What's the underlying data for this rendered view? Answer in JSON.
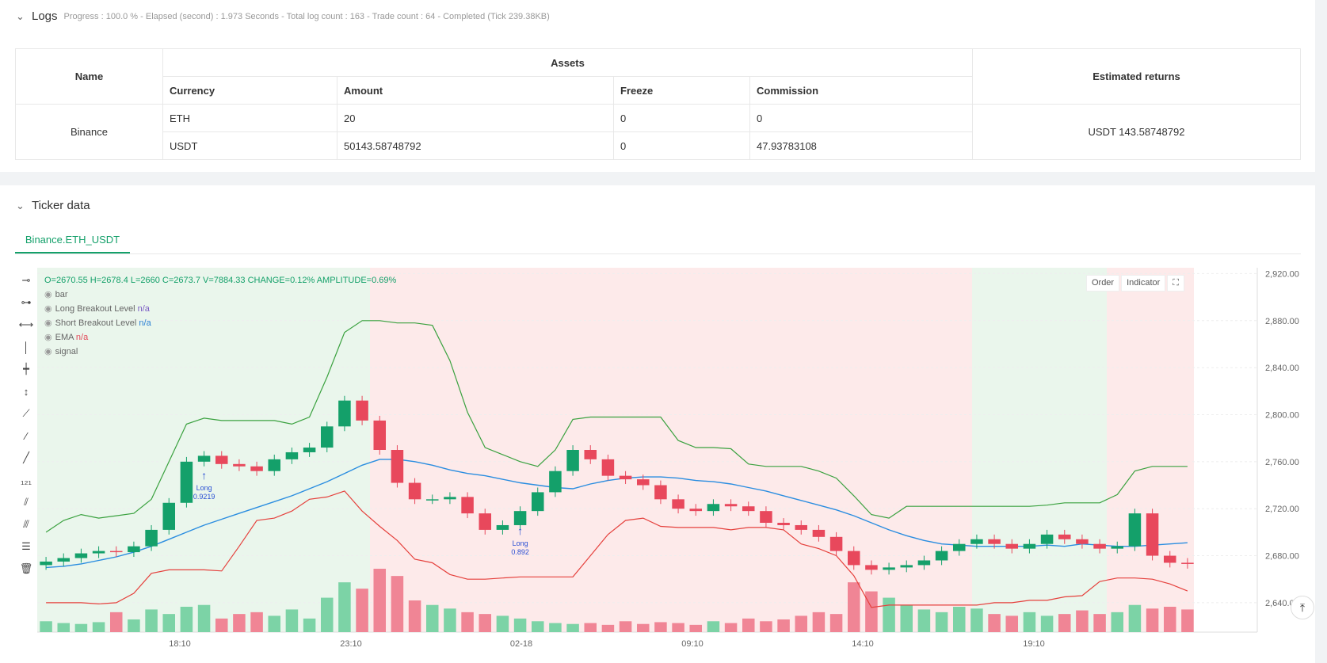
{
  "logs": {
    "title": "Logs",
    "progress": "Progress : 100.0 % - Elapsed (second) : 1.973  Seconds - Total log count : 163 - Trade count : 64 - Completed (Tick 239.38KB)"
  },
  "table": {
    "headers": {
      "name": "Name",
      "assets": "Assets",
      "returns": "Estimated returns",
      "currency": "Currency",
      "amount": "Amount",
      "freeze": "Freeze",
      "commission": "Commission"
    },
    "exchange": "Binance",
    "rows": [
      {
        "currency": "ETH",
        "amount": "20",
        "freeze": "0",
        "commission": "0"
      },
      {
        "currency": "USDT",
        "amount": "50143.58748792",
        "freeze": "0",
        "commission": "47.93783108"
      }
    ],
    "returns": "USDT 143.58748792"
  },
  "ticker": {
    "title": "Ticker data",
    "tab": "Binance.ETH_USDT"
  },
  "legend": {
    "ohlc": "O=2670.55 H=2678.4 L=2660 C=2673.7 V=7884.33 CHANGE=0.12% AMPLITUDE=0.69%",
    "items": [
      {
        "name": "bar",
        "value": ""
      },
      {
        "name": "Long Breakout Level",
        "value": "n/a"
      },
      {
        "name": "Short Breakout Level",
        "value": "n/a"
      },
      {
        "name": "EMA",
        "value": "n/a"
      },
      {
        "name": "signal",
        "value": ""
      }
    ]
  },
  "chart_buttons": {
    "order": "Order",
    "indicator": "Indicator"
  },
  "chart_data": {
    "type": "candlestick",
    "y_ticks": [
      "2,920.00",
      "2,880.00",
      "2,840.00",
      "2,800.00",
      "2,760.00",
      "2,720.00",
      "2,680.00",
      "2,640.00"
    ],
    "x_ticks": [
      "18:10",
      "23:10",
      "02-18",
      "09:10",
      "14:10",
      "19:10"
    ],
    "signals": [
      {
        "label": "Long",
        "value": "0.9219"
      },
      {
        "label": "Long",
        "value": "0.892"
      }
    ],
    "ema": [
      2670,
      2671,
      2673,
      2676,
      2679,
      2683,
      2688,
      2694,
      2700,
      2706,
      2711,
      2716,
      2721,
      2726,
      2731,
      2737,
      2743,
      2750,
      2757,
      2762,
      2762,
      2760,
      2757,
      2753,
      2750,
      2748,
      2745,
      2742,
      2740,
      2738,
      2737,
      2741,
      2744,
      2746,
      2747,
      2747,
      2746,
      2744,
      2743,
      2741,
      2738,
      2735,
      2731,
      2727,
      2723,
      2719,
      2714,
      2708,
      2702,
      2697,
      2693,
      2690,
      2689,
      2688,
      2688,
      2688,
      2688,
      2689,
      2688,
      2690,
      2689,
      2688,
      2688,
      2689,
      2690,
      2691
    ],
    "upper": [
      2700,
      2710,
      2715,
      2712,
      2714,
      2716,
      2728,
      2760,
      2792,
      2797,
      2795,
      2795,
      2795,
      2795,
      2792,
      2798,
      2832,
      2870,
      2880,
      2880,
      2878,
      2878,
      2876,
      2846,
      2802,
      2772,
      2766,
      2760,
      2756,
      2770,
      2796,
      2798,
      2798,
      2798,
      2798,
      2798,
      2778,
      2772,
      2772,
      2771,
      2758,
      2756,
      2756,
      2756,
      2752,
      2746,
      2731,
      2715,
      2712,
      2722,
      2722,
      2722,
      2722,
      2722,
      2722,
      2722,
      2722,
      2723,
      2725,
      2725,
      2725,
      2732,
      2752,
      2756,
      2756,
      2756
    ],
    "lower": [
      2640,
      2640,
      2640,
      2639,
      2640,
      2648,
      2665,
      2668,
      2668,
      2668,
      2667,
      2688,
      2710,
      2712,
      2718,
      2728,
      2730,
      2735,
      2718,
      2705,
      2693,
      2677,
      2674,
      2664,
      2660,
      2660,
      2661,
      2662,
      2662,
      2662,
      2662,
      2680,
      2698,
      2710,
      2712,
      2705,
      2704,
      2704,
      2704,
      2702,
      2704,
      2704,
      2702,
      2690,
      2686,
      2680,
      2663,
      2636,
      2638,
      2638,
      2638,
      2638,
      2638,
      2638,
      2640,
      2640,
      2642,
      2642,
      2645,
      2646,
      2658,
      2661,
      2661,
      2660,
      2656,
      2650
    ],
    "closes": [
      2675,
      2678,
      2682,
      2684,
      2683,
      2688,
      2702,
      2725,
      2760,
      2765,
      2758,
      2756,
      2752,
      2762,
      2768,
      2772,
      2790,
      2812,
      2795,
      2770,
      2742,
      2728,
      2728,
      2730,
      2716,
      2702,
      2706,
      2718,
      2734,
      2752,
      2770,
      2762,
      2748,
      2745,
      2740,
      2728,
      2720,
      2718,
      2724,
      2722,
      2718,
      2708,
      2706,
      2702,
      2696,
      2684,
      2672,
      2668,
      2670,
      2672,
      2676,
      2684,
      2690,
      2694,
      2690,
      2686,
      2690,
      2698,
      2694,
      2690,
      2686,
      2688,
      2716,
      2680,
      2674,
      2673
    ],
    "volumes": [
      12,
      10,
      9,
      11,
      22,
      14,
      25,
      20,
      28,
      30,
      15,
      20,
      22,
      18,
      25,
      15,
      38,
      55,
      48,
      70,
      62,
      35,
      30,
      26,
      22,
      20,
      18,
      15,
      12,
      10,
      9,
      10,
      8,
      12,
      9,
      11,
      10,
      8,
      12,
      10,
      15,
      12,
      14,
      18,
      22,
      20,
      55,
      45,
      38,
      30,
      25,
      22,
      28,
      26,
      20,
      18,
      22,
      18,
      20,
      24,
      20,
      22,
      30,
      26,
      28,
      25
    ]
  }
}
